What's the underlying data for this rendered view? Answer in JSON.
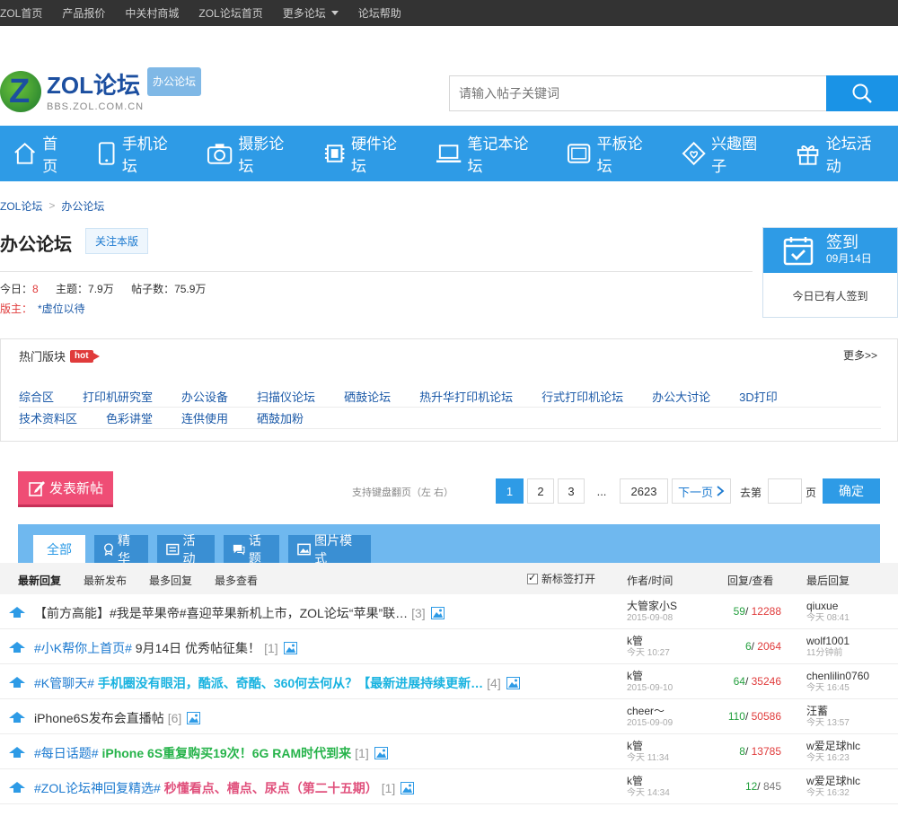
{
  "topbar": {
    "items": [
      "ZOL首页",
      "产品报价",
      "中关村商城",
      "ZOL论坛首页",
      "更多论坛",
      "论坛帮助"
    ]
  },
  "logo": {
    "title": "ZOL论坛",
    "tag": "办公论坛",
    "sub": "BBS.ZOL.COM.CN"
  },
  "search": {
    "placeholder": "请输入帖子关键词"
  },
  "nav": {
    "items": [
      "首页",
      "手机论坛",
      "摄影论坛",
      "硬件论坛",
      "笔记本论坛",
      "平板论坛",
      "兴趣圈子",
      "论坛活动"
    ]
  },
  "breadcrumb": {
    "root": "ZOL论坛",
    "sep": ">",
    "current": "办公论坛"
  },
  "forum": {
    "name": "办公论坛",
    "follow": "关注本版",
    "today_label": "今日：",
    "today_value": "8",
    "topics": "主题：7.9万",
    "posts": "帖子数：75.9万",
    "mods_label": "版主：",
    "mods_value": "*虚位以待"
  },
  "signin": {
    "label": "签到",
    "date": "09月14日",
    "status": "今日已有人签到"
  },
  "hot": {
    "title": "热门版块",
    "badge": "hot",
    "more": "更多>>",
    "row1": [
      "综合区",
      "打印机研究室",
      "办公设备",
      "扫描仪论坛",
      "硒鼓论坛",
      "热升华打印机论坛",
      "行式打印机论坛",
      "办公大讨论",
      "3D打印"
    ],
    "row2": [
      "技术资料区",
      "色彩讲堂",
      "连供使用",
      "硒鼓加粉"
    ]
  },
  "actions": {
    "post": "发表新帖",
    "kbd": "支持键盘翻页（左  右）",
    "pages": [
      "1",
      "2",
      "3",
      "...",
      "2623"
    ],
    "next": "下一页",
    "goto": "去第",
    "page_unit": "页",
    "ok": "确定"
  },
  "tabs": [
    "全部",
    "精华",
    "活动",
    "话题",
    "图片模式"
  ],
  "listhead": {
    "sorts": [
      "最新回复",
      "最新发布",
      "最多回复",
      "最多查看"
    ],
    "newtab": "新标签打开",
    "author": "作者/时间",
    "replies": "回复/查看",
    "last": "最后回复"
  },
  "threads": [
    {
      "tag": "",
      "title": "【前方高能】#我是苹果帝#喜迎苹果新机上市，ZOL论坛“苹果”联…",
      "cnt": "[3]",
      "author": "大管家小S",
      "atime": "2015-09-08",
      "r": "59",
      "v": "12288",
      "last": "qiuxue",
      "ltime": "今天 08:41"
    },
    {
      "tag": "#小K帮你上首页#",
      "title": "9月14日 优秀帖征集！",
      "cnt": "[1]",
      "author": "k管",
      "atime": "今天 10:27",
      "r": "6",
      "v": "2064",
      "last": "wolf1001",
      "ltime": "11分钟前"
    },
    {
      "tag": "#K管聊天#",
      "title": "手机圈没有眼泪，酷派、奇酷、360何去何从？【最新进展持续更新…",
      "cnt": "[4]",
      "author": "k管",
      "atime": "2015-09-10",
      "r": "64",
      "v": "35246",
      "last": "chenlilin0760",
      "ltime": "今天 16:45"
    },
    {
      "tag": "",
      "title": "iPhone6S发布会直播帖",
      "cnt": "[6]",
      "author": "cheer～",
      "atime": "2015-09-09",
      "r": "110",
      "v": "50586",
      "last": "汪蓄",
      "ltime": "今天 13:57"
    },
    {
      "tag": "#每日话题#",
      "title": "iPhone 6S重复购买19次！6G RAM时代到来",
      "cnt": "[1]",
      "author": "k管",
      "atime": "今天 11:34",
      "r": "8",
      "v": "13785",
      "last": "w爱足球hlc",
      "ltime": "今天 16:23"
    },
    {
      "tag": "#ZOL论坛神回复精选#",
      "title": "秒懂看点、槽点、尿点（第二十五期）",
      "cnt": "[1]",
      "author": "k管",
      "atime": "今天 14:34",
      "r": "12",
      "v": "845",
      "last": "w爱足球hlc",
      "ltime": "今天 16:32"
    }
  ]
}
